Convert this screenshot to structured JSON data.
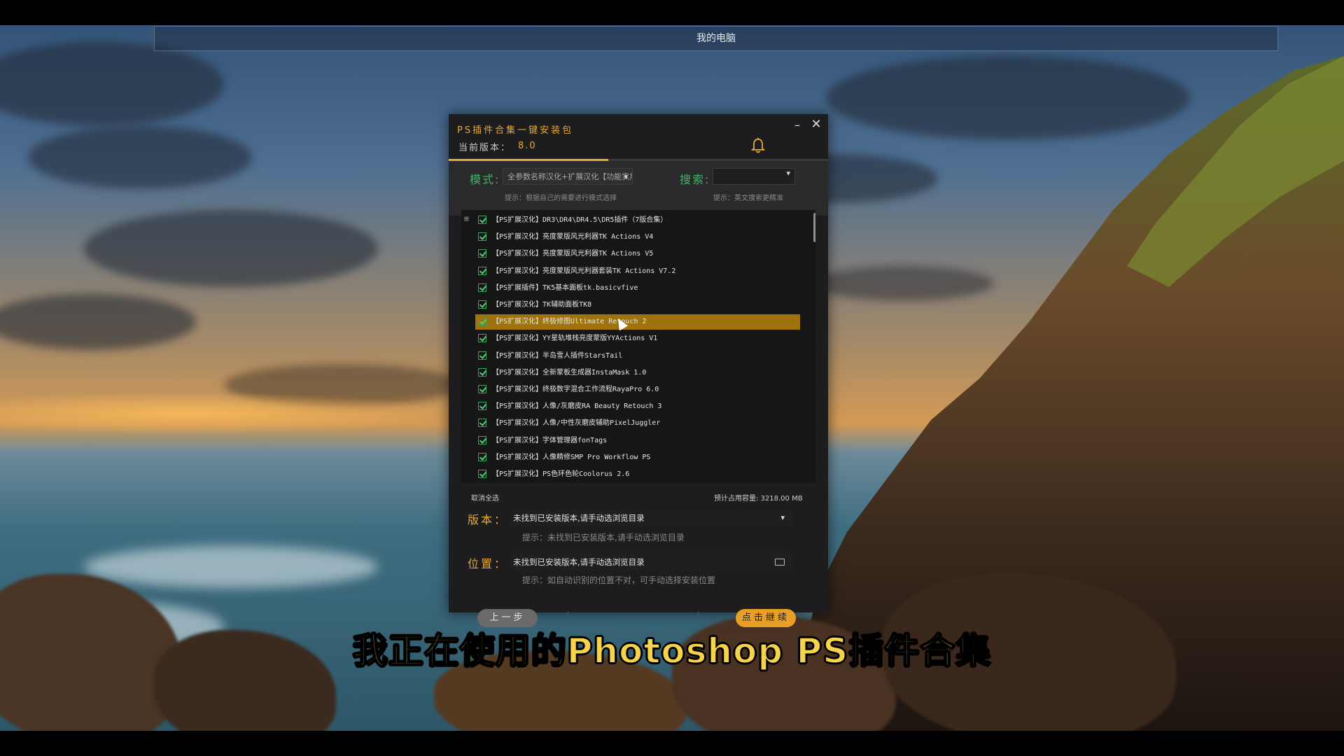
{
  "desktop": {
    "topbar_title": "我的电脑"
  },
  "app": {
    "title": "PS插件合集一键安装包",
    "version_label": "当前版本：",
    "version_value": "8.0",
    "minimize_glyph": "–",
    "close_glyph": "✕",
    "progress_fraction": 0.42,
    "accent_color": "#e7a935",
    "label_green": "#46b16a",
    "mode": {
      "label": "模式:",
      "selected": "全参数名称汉化+扩展汉化【功能实用】",
      "hint": "提示：根据自己的需要进行模式选择"
    },
    "search": {
      "label": "搜索:",
      "value": "",
      "hint": "提示：英文搜索更精准"
    },
    "list": {
      "expander": "⊞",
      "items": [
        {
          "text": "【PS扩展汉化】DR3\\DR4\\DR4.5\\DR5插件（7版合集）",
          "checked": true
        },
        {
          "text": "【PS扩展汉化】亮度蒙版风光利器TK Actions V4",
          "checked": true
        },
        {
          "text": "【PS扩展汉化】亮度蒙版风光利器TK Actions V5",
          "checked": true
        },
        {
          "text": "【PS扩展汉化】亮度蒙版风光利器套装TK Actions V7.2",
          "checked": true
        },
        {
          "text": "【PS扩展插件】TK5基本面板tk.basicvfive",
          "checked": true
        },
        {
          "text": "【PS扩展汉化】TK辅助面板TK8",
          "checked": true
        },
        {
          "text": "【PS扩展汉化】终极修图Ultimate Retouch 2",
          "checked": true,
          "highlighted": true
        },
        {
          "text": "【PS扩展汉化】YY星轨堆栈亮度蒙版YYActions V1",
          "checked": true
        },
        {
          "text": "【PS扩展汉化】半岛雪人插件StarsTail",
          "checked": true
        },
        {
          "text": "【PS扩展汉化】全新蒙板生成器InstaMask 1.0",
          "checked": true
        },
        {
          "text": "【PS扩展汉化】终极数字混合工作流程RayaPro 6.0",
          "checked": true
        },
        {
          "text": "【PS扩展汉化】人像/灰磨皮RA Beauty Retouch 3",
          "checked": true
        },
        {
          "text": "【PS扩展汉化】人像/中性灰磨皮辅助PixelJuggler",
          "checked": true
        },
        {
          "text": "【PS扩展汉化】字体管理器fonTags",
          "checked": true
        },
        {
          "text": "【PS扩展汉化】人像精修SMP Pro Workflow PS",
          "checked": true
        },
        {
          "text": "【PS扩展汉化】PS色环色轮Coolorus 2.6",
          "checked": true
        }
      ]
    },
    "deselect_all": "取消全选",
    "capacity": "预计占用容量: 3218.00 MB",
    "version_select": {
      "label": "版本：",
      "value": "未找到已安装版本,请手动选浏览目录",
      "hint": "提示：未找到已安装版本,请手动选浏览目录"
    },
    "location": {
      "label": "位置：",
      "value": "未找到已安装版本,请手动选浏览目录",
      "hint": "提示：如自动识别的位置不对，可手动选择安装位置"
    },
    "prev_button": "上一步",
    "next_button": "点击继续"
  },
  "subtitle": "我正在使用的Photoshop PS插件合集"
}
